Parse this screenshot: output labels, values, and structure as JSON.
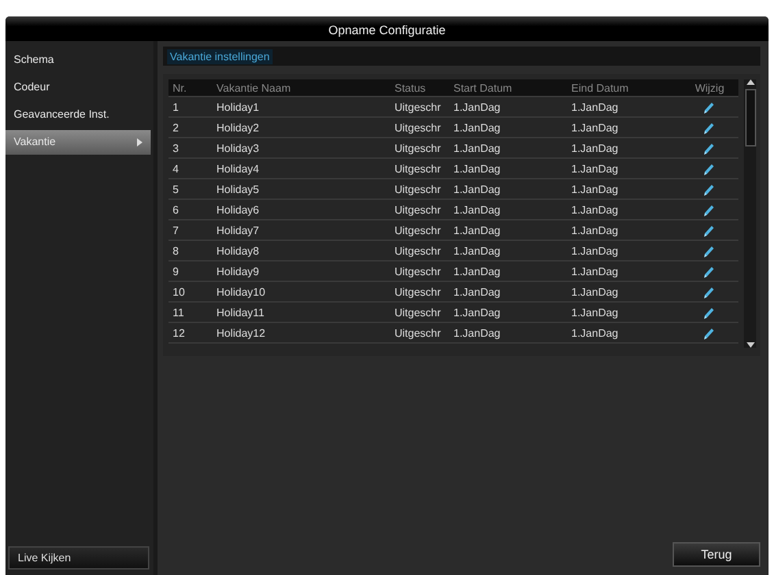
{
  "window": {
    "title": "Opname Configuratie"
  },
  "sidebar": {
    "items": [
      {
        "label": "Schema",
        "selected": false
      },
      {
        "label": "Codeur",
        "selected": false
      },
      {
        "label": "Geavanceerde Inst.",
        "selected": false
      },
      {
        "label": "Vakantie",
        "selected": true
      }
    ],
    "bottom_button": "Live Kijken"
  },
  "tab": "Vakantie instellingen",
  "table": {
    "columns": [
      "Nr.",
      "Vakantie Naam",
      "Status",
      "Start Datum",
      "Eind Datum",
      "Wijzig"
    ],
    "rows": [
      {
        "nr": "1",
        "name": "Holiday1",
        "status": "Uitgeschr",
        "start": "1.JanDag",
        "end": "1.JanDag"
      },
      {
        "nr": "2",
        "name": "Holiday2",
        "status": "Uitgeschr",
        "start": "1.JanDag",
        "end": "1.JanDag"
      },
      {
        "nr": "3",
        "name": "Holiday3",
        "status": "Uitgeschr",
        "start": "1.JanDag",
        "end": "1.JanDag"
      },
      {
        "nr": "4",
        "name": "Holiday4",
        "status": "Uitgeschr",
        "start": "1.JanDag",
        "end": "1.JanDag"
      },
      {
        "nr": "5",
        "name": "Holiday5",
        "status": "Uitgeschr",
        "start": "1.JanDag",
        "end": "1.JanDag"
      },
      {
        "nr": "6",
        "name": "Holiday6",
        "status": "Uitgeschr",
        "start": "1.JanDag",
        "end": "1.JanDag"
      },
      {
        "nr": "7",
        "name": "Holiday7",
        "status": "Uitgeschr",
        "start": "1.JanDag",
        "end": "1.JanDag"
      },
      {
        "nr": "8",
        "name": "Holiday8",
        "status": "Uitgeschr",
        "start": "1.JanDag",
        "end": "1.JanDag"
      },
      {
        "nr": "9",
        "name": "Holiday9",
        "status": "Uitgeschr",
        "start": "1.JanDag",
        "end": "1.JanDag"
      },
      {
        "nr": "10",
        "name": "Holiday10",
        "status": "Uitgeschr",
        "start": "1.JanDag",
        "end": "1.JanDag"
      },
      {
        "nr": "11",
        "name": "Holiday11",
        "status": "Uitgeschr",
        "start": "1.JanDag",
        "end": "1.JanDag"
      },
      {
        "nr": "12",
        "name": "Holiday12",
        "status": "Uitgeschr",
        "start": "1.JanDag",
        "end": "1.JanDag"
      }
    ]
  },
  "buttons": [
    "Terug"
  ]
}
